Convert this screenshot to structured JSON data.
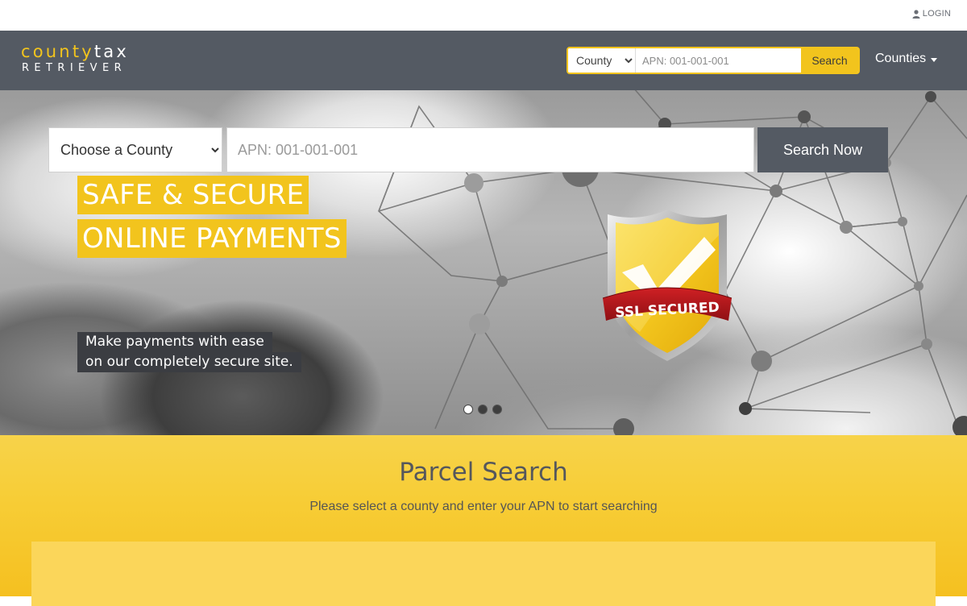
{
  "topbar": {
    "login_label": "LOGIN"
  },
  "logo": {
    "word1": "county",
    "word2": "tax",
    "tagline": "RETRIEVER"
  },
  "nav_search": {
    "county_selected": "County",
    "apn_placeholder": "APN: 001-001-001",
    "button_label": "Search"
  },
  "nav": {
    "counties_label": "Counties"
  },
  "hero": {
    "headline_line1": "SAFE & SECURE",
    "headline_line2": "ONLINE PAYMENTS",
    "sub_line1": "Make payments with ease",
    "sub_line2": "on our completely secure site.",
    "badge_text": "SSL SECURED",
    "slide_count": 3,
    "active_slide": 1
  },
  "parcel_search": {
    "title": "Parcel Search",
    "subtitle": "Please select a county and enter your APN to start searching",
    "county_selected": "Choose a County",
    "apn_placeholder": "APN: 001-001-001",
    "button_label": "Search Now"
  },
  "colors": {
    "brand_yellow": "#f2c41d",
    "navbar_gray": "#545a63",
    "badge_red": "#b5161b"
  }
}
